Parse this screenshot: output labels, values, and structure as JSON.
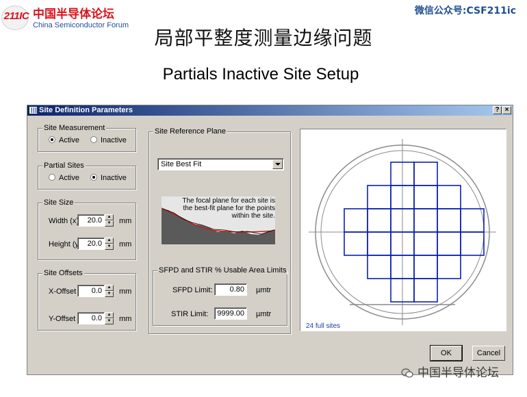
{
  "slide": {
    "logo_number": "211IC",
    "logo_cn": "中国半导体论坛",
    "logo_en": "China Semiconductor Forum",
    "wechat_id": "微信公众号:CSF211ic",
    "title_cn": "局部平整度测量边缘问题",
    "title_en": "Partials Inactive Site Setup",
    "watermark": "中国半导体论坛"
  },
  "dialog": {
    "title": "Site Definition Parameters",
    "help_label": "?",
    "close_label": "×",
    "site_measurement": {
      "legend": "Site Measurement",
      "options": [
        {
          "label": "Active",
          "selected": true
        },
        {
          "label": "Inactive",
          "selected": false
        }
      ]
    },
    "partial_sites": {
      "legend": "Partial Sites",
      "options": [
        {
          "label": "Active",
          "selected": false
        },
        {
          "label": "Inactive",
          "selected": true
        }
      ]
    },
    "site_size": {
      "legend": "Site Size",
      "width_label": "Width (x)",
      "width_value": "20.0",
      "height_label": "Height (y)",
      "height_value": "20.0",
      "unit": "mm"
    },
    "site_offsets": {
      "legend": "Site Offsets",
      "x_label": "X-Offset",
      "x_value": "0.0",
      "y_label": "Y-Offset",
      "y_value": "0.0",
      "unit": "mm"
    },
    "reference_plane": {
      "legend": "Site Reference Plane",
      "selected": "Site Best Fit",
      "description": "The focal plane for each site is the best-fit plane for the points within the site."
    },
    "usable_area": {
      "legend": "SFPD and STIR % Usable Area Limits",
      "sfpd_label": "SFPD Limit:",
      "sfpd_value": "0.80",
      "stir_label": "STIR Limit:",
      "stir_value": "9999.00",
      "unit": "µmtr"
    },
    "wafer_map": {
      "footer": "24 full sites",
      "grid_color": "#0a1fb0",
      "row_columns": [
        [
          3,
          4
        ],
        [
          2,
          5
        ],
        [
          1,
          6
        ],
        [
          1,
          6
        ],
        [
          2,
          5
        ],
        [
          3,
          4
        ]
      ]
    },
    "ok_label": "OK",
    "cancel_label": "Cancel"
  },
  "colors": {
    "logo_red": "#d8141c",
    "wechat_blue": "#1f4e92",
    "dialog_face": "#d4d0c8",
    "titlebar": "#0a246a"
  }
}
